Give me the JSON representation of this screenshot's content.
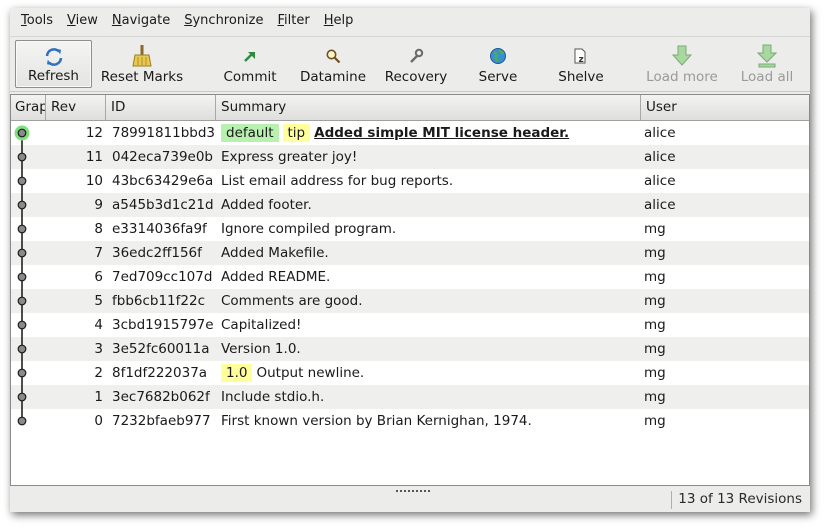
{
  "menubar": {
    "items": [
      {
        "first": "T",
        "rest": "ools"
      },
      {
        "first": "V",
        "rest": "iew"
      },
      {
        "first": "N",
        "rest": "avigate"
      },
      {
        "first": "S",
        "rest": "ynchronize"
      },
      {
        "first": "F",
        "rest": "ilter"
      },
      {
        "first": "H",
        "rest": "elp"
      }
    ]
  },
  "toolbar": {
    "refresh": "Refresh",
    "reset_marks": "Reset Marks",
    "commit": "Commit",
    "datamine": "Datamine",
    "recovery": "Recovery",
    "serve": "Serve",
    "shelve": "Shelve",
    "load_more": "Load more",
    "load_all": "Load all"
  },
  "columns": [
    "Graph",
    "Rev",
    "ID",
    "Summary",
    "User"
  ],
  "rows": [
    {
      "rev": "12",
      "id": "78991811bbd3",
      "tags": [
        "default",
        "tip"
      ],
      "summary": "Added simple MIT license header.",
      "user": "alice"
    },
    {
      "rev": "11",
      "id": "042eca739e0b",
      "tags": [],
      "summary": "Express greater joy!",
      "user": "alice"
    },
    {
      "rev": "10",
      "id": "43bc63429e6a",
      "tags": [],
      "summary": "List email address for bug reports.",
      "user": "alice"
    },
    {
      "rev": "9",
      "id": "a545b3d1c21d",
      "tags": [],
      "summary": "Added footer.",
      "user": "alice"
    },
    {
      "rev": "8",
      "id": "e3314036fa9f",
      "tags": [],
      "summary": "Ignore compiled program.",
      "user": "mg"
    },
    {
      "rev": "7",
      "id": "36edc2ff156f",
      "tags": [],
      "summary": "Added Makefile.",
      "user": "mg"
    },
    {
      "rev": "6",
      "id": "7ed709cc107d",
      "tags": [],
      "summary": "Added README.",
      "user": "mg"
    },
    {
      "rev": "5",
      "id": "fbb6cb11f22c",
      "tags": [],
      "summary": "Comments are good.",
      "user": "mg"
    },
    {
      "rev": "4",
      "id": "3cbd1915797e",
      "tags": [],
      "summary": "Capitalized!",
      "user": "mg"
    },
    {
      "rev": "3",
      "id": "3e52fc60011a",
      "tags": [],
      "summary": "Version 1.0.",
      "user": "mg"
    },
    {
      "rev": "2",
      "id": "8f1df222037a",
      "tags": [
        "1.0"
      ],
      "summary": "Output newline.",
      "user": "mg"
    },
    {
      "rev": "1",
      "id": "3ec7682b062f",
      "tags": [],
      "summary": "Include stdio.h.",
      "user": "mg"
    },
    {
      "rev": "0",
      "id": "7232bfaeb977",
      "tags": [],
      "summary": "First known version by Brian Kernighan, 1974.",
      "user": "mg"
    }
  ],
  "status": {
    "text": "13 of 13 Revisions"
  },
  "colors": {
    "branch_tag": "#b8f0b0",
    "tip_tag": "#ffff9c",
    "version_tag": "#ffff9c",
    "current_node": "#7ee07a"
  }
}
